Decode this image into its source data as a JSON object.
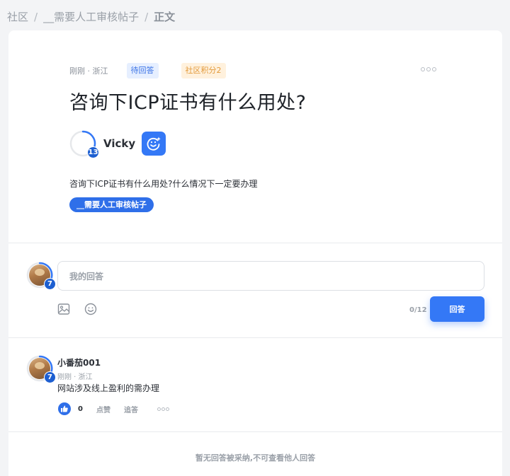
{
  "breadcrumb": {
    "root": "社区",
    "sep1": "/",
    "topic": "__需要人工审核帖子",
    "sep2": "/",
    "current": "正文"
  },
  "post": {
    "meta": "刚刚 · 浙江",
    "status_tag": "待回答",
    "points_tag": "社区积分2",
    "title": "咨询下ICP证书有什么用处?",
    "author_name": "Vicky",
    "author_level": "13",
    "body": "咨询下ICP证书有什么用处?什么情况下一定要办理",
    "topic_pill": "__需要人工审核帖子"
  },
  "answer": {
    "my_level": "7",
    "placeholder": "我的回答",
    "counter": "0/12",
    "submit_label": "回答"
  },
  "reply": {
    "name": "小番茄001",
    "level": "7",
    "meta": "刚刚 · 浙江",
    "text": "网站涉及线上盈利的需办理",
    "likes": "0",
    "like_label": "点赞",
    "follow_label": "追答"
  },
  "footer_note": "暂无回答被采纳,不可查看他人回答",
  "colors": {
    "accent": "#3478f6",
    "level_badge": "#1d5fd1",
    "tag_wait_bg": "#e6efff",
    "tag_points_bg": "#fff1dd"
  }
}
